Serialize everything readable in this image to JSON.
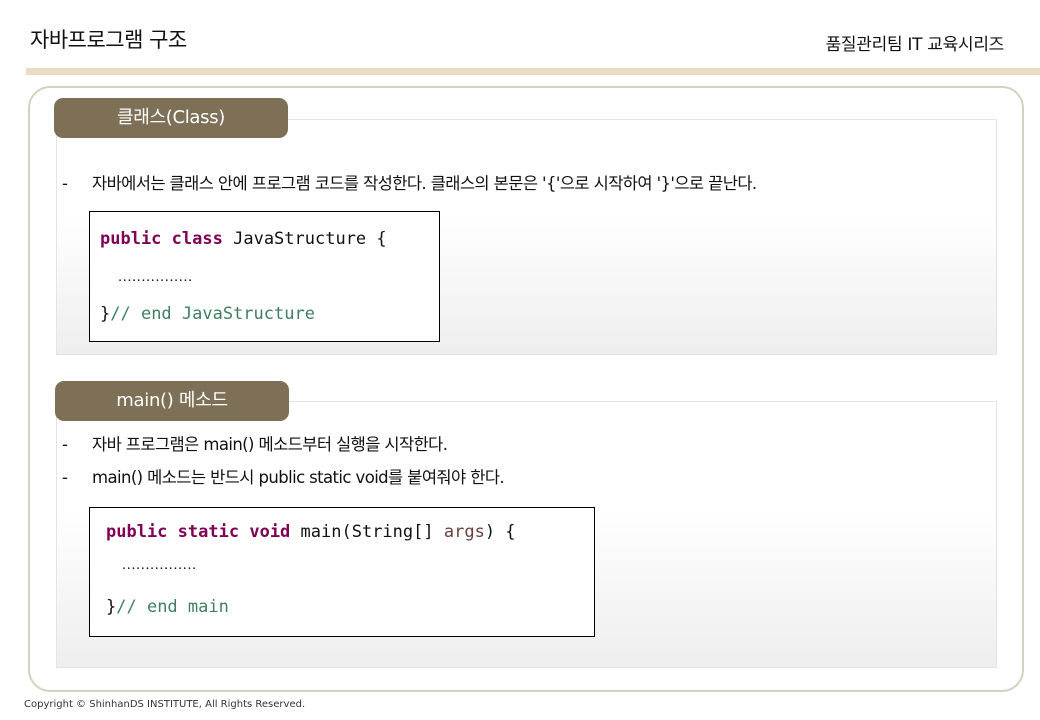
{
  "header": {
    "title": "자바프로그램 구조",
    "series": "품질관리팀 IT 교육시리즈"
  },
  "sections": [
    {
      "tab": "클래스(Class)",
      "bullets": [
        "자바에서는 클래스 안에 프로그램 코드를 작성한다. 클래스의 본문은 '{'으로 시작하여 '}'으로 끝난다."
      ],
      "code": {
        "kw1": "public",
        "kw2": "class",
        "name": "JavaStructure",
        "open": "{",
        "dots": "................",
        "close": "}",
        "comment": "// end JavaStructure"
      }
    },
    {
      "tab": "main() 메소드",
      "bullets": [
        "자바 프로그램은 main() 메소드부터 실행을 시작한다.",
        "main() 메소드는 반드시 public static void를 붙여줘야 한다."
      ],
      "code": {
        "kw1": "public",
        "kw2": "static",
        "kw3": "void",
        "sig": "main(String[]",
        "arg": "args",
        "tail": ") {",
        "dots": "................",
        "close": "}",
        "comment": "// end main"
      }
    }
  ],
  "bullet_dash": "-",
  "footer": {
    "copyright": "Copyright © ShinhanDS INSTITUTE, All Rights Reserved."
  },
  "colors": {
    "tab_bg": "#7d7057",
    "header_rule": "#eadbc4",
    "frame_border": "#d5d1bf",
    "keyword": "#7f0055",
    "comment": "#3f7f5f",
    "variable": "#6a3e3e"
  }
}
